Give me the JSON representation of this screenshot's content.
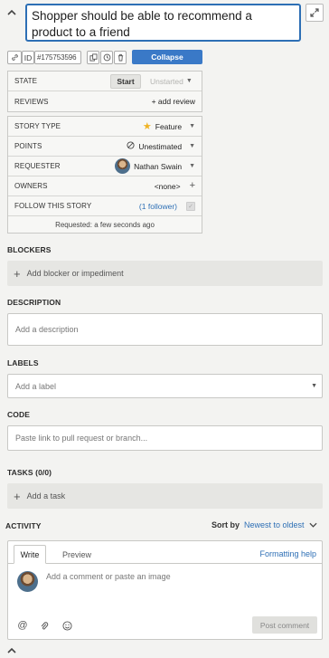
{
  "story": {
    "title": "Shopper should be able to recommend a product to a friend",
    "id_label": "ID",
    "id_value": "#175753596",
    "collapse_label": "Collapse"
  },
  "state_panel": {
    "state_label": "STATE",
    "start_label": "Start",
    "state_value": "Unstarted",
    "reviews_label": "REVIEWS",
    "add_review_label": "+ add review"
  },
  "details": {
    "story_type_label": "STORY TYPE",
    "story_type_value": "Feature",
    "points_label": "POINTS",
    "points_value": "Unestimated",
    "requester_label": "REQUESTER",
    "requester_value": "Nathan Swain",
    "owners_label": "OWNERS",
    "owners_value": "<none>",
    "follow_label": "FOLLOW THIS STORY",
    "follow_count": "1",
    "follow_word": "follower",
    "requested_text": "Requested: a few seconds ago"
  },
  "blockers": {
    "heading": "BLOCKERS",
    "add_label": "Add blocker or impediment"
  },
  "description": {
    "heading": "DESCRIPTION",
    "placeholder": "Add a description"
  },
  "labels": {
    "heading": "LABELS",
    "placeholder": "Add a label"
  },
  "code": {
    "heading": "CODE",
    "placeholder": "Paste link to pull request or branch..."
  },
  "tasks": {
    "heading": "TASKS (0/0)",
    "add_label": "Add a task"
  },
  "activity": {
    "heading": "ACTIVITY",
    "sort_by_label": "Sort by",
    "sort_value": "Newest to oldest",
    "tab_write": "Write",
    "tab_preview": "Preview",
    "formatting_help": "Formatting help",
    "comment_placeholder": "Add a comment or paste an image",
    "post_label": "Post comment"
  },
  "colors": {
    "accent": "#2d6fb5",
    "collapse_bg": "#3a79c7",
    "star": "#f0b323"
  },
  "icons": [
    "chevron-up-icon",
    "expand-icon",
    "link-icon",
    "copy-icon",
    "history-icon",
    "trash-icon",
    "star-icon",
    "unestimated-icon",
    "plus-icon",
    "at-icon",
    "paperclip-icon",
    "emoji-icon",
    "chevron-down-icon"
  ]
}
